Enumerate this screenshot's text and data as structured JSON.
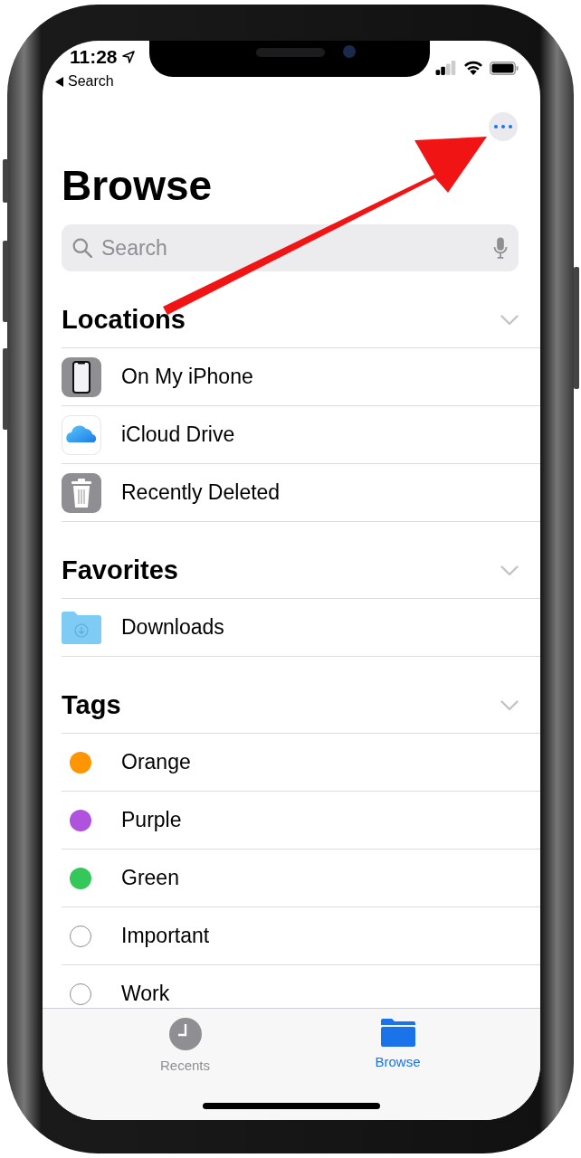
{
  "status_bar": {
    "time": "11:28",
    "back_label": "Search"
  },
  "title": "Browse",
  "search": {
    "placeholder": "Search"
  },
  "sections": [
    {
      "title": "Locations",
      "expanded": true,
      "items": [
        {
          "label": "On My iPhone",
          "kind": "phone"
        },
        {
          "label": "iCloud Drive",
          "kind": "cloud"
        },
        {
          "label": "Recently Deleted",
          "kind": "trash"
        }
      ]
    },
    {
      "title": "Favorites",
      "expanded": true,
      "items": [
        {
          "label": "Downloads",
          "kind": "folder"
        }
      ]
    },
    {
      "title": "Tags",
      "expanded": true,
      "items": [
        {
          "label": "Orange",
          "kind": "tag",
          "color": "#ff9500"
        },
        {
          "label": "Purple",
          "kind": "tag",
          "color": "#af52de"
        },
        {
          "label": "Green",
          "kind": "tag",
          "color": "#34c759"
        },
        {
          "label": "Important",
          "kind": "tag"
        },
        {
          "label": "Work",
          "kind": "tag"
        }
      ]
    }
  ],
  "tab_bar": [
    {
      "label": "Recents",
      "selected": false
    },
    {
      "label": "Browse",
      "selected": true
    }
  ]
}
